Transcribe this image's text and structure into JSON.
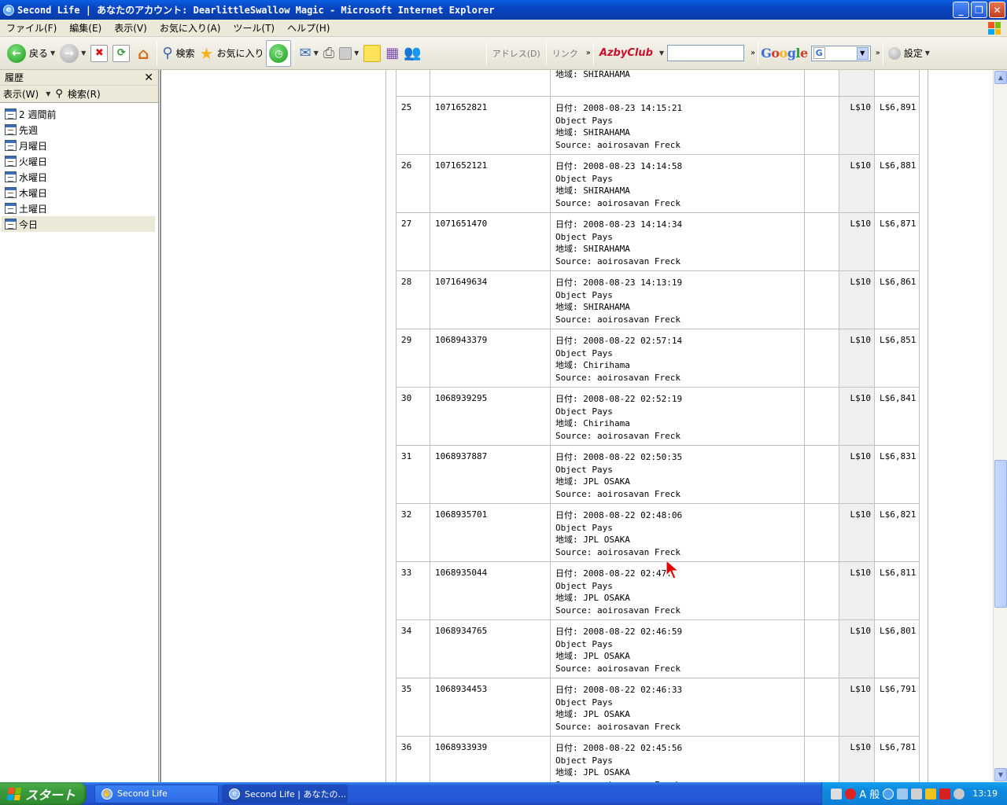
{
  "window": {
    "title": "Second Life | あなたのアカウント: DearlittleSwallow Magic - Microsoft Internet Explorer"
  },
  "menu": [
    "ファイル(F)",
    "編集(E)",
    "表示(V)",
    "お気に入り(A)",
    "ツール(T)",
    "ヘルプ(H)"
  ],
  "toolbar": {
    "back_label": "戻る",
    "search_label": "検索",
    "favorites_label": "お気に入り",
    "address_label": "アドレス(D)",
    "links_label": "リンク",
    "azby_label": "AzbyClub",
    "google_label": "Google",
    "google_select": "G",
    "settings_label": "設定"
  },
  "sidebar": {
    "title": "履歴",
    "view_label": "表示(W)",
    "search_label": "検索(R)",
    "items": [
      "2 週間前",
      "先週",
      "月曜日",
      "火曜日",
      "水曜日",
      "木曜日",
      "土曜日",
      "今日"
    ]
  },
  "partial_top": {
    "region": "地域: SHIRAHAMA"
  },
  "transactions": [
    {
      "num": "25",
      "id": "1071652821",
      "date": "日付: 2008-08-23 14:15:21",
      "type": "Object Pays",
      "region": "地域: SHIRAHAMA",
      "source": "Source: aoirosavan Freck",
      "amount": "L$10",
      "balance": "L$6,891"
    },
    {
      "num": "26",
      "id": "1071652121",
      "date": "日付: 2008-08-23 14:14:58",
      "type": "Object Pays",
      "region": "地域: SHIRAHAMA",
      "source": "Source: aoirosavan Freck",
      "amount": "L$10",
      "balance": "L$6,881"
    },
    {
      "num": "27",
      "id": "1071651470",
      "date": "日付: 2008-08-23 14:14:34",
      "type": "Object Pays",
      "region": "地域: SHIRAHAMA",
      "source": "Source: aoirosavan Freck",
      "amount": "L$10",
      "balance": "L$6,871"
    },
    {
      "num": "28",
      "id": "1071649634",
      "date": "日付: 2008-08-23 14:13:19",
      "type": "Object Pays",
      "region": "地域: SHIRAHAMA",
      "source": "Source: aoirosavan Freck",
      "amount": "L$10",
      "balance": "L$6,861"
    },
    {
      "num": "29",
      "id": "1068943379",
      "date": "日付: 2008-08-22 02:57:14",
      "type": "Object Pays",
      "region": "地域: Chirihama",
      "source": "Source: aoirosavan Freck",
      "amount": "L$10",
      "balance": "L$6,851"
    },
    {
      "num": "30",
      "id": "1068939295",
      "date": "日付: 2008-08-22 02:52:19",
      "type": "Object Pays",
      "region": "地域: Chirihama",
      "source": "Source: aoirosavan Freck",
      "amount": "L$10",
      "balance": "L$6,841"
    },
    {
      "num": "31",
      "id": "1068937887",
      "date": "日付: 2008-08-22 02:50:35",
      "type": "Object Pays",
      "region": "地域: JPL OSAKA",
      "source": "Source: aoirosavan Freck",
      "amount": "L$10",
      "balance": "L$6,831"
    },
    {
      "num": "32",
      "id": "1068935701",
      "date": "日付: 2008-08-22 02:48:06",
      "type": "Object Pays",
      "region": "地域: JPL OSAKA",
      "source": "Source: aoirosavan Freck",
      "amount": "L$10",
      "balance": "L$6,821"
    },
    {
      "num": "33",
      "id": "1068935044",
      "date": "日付: 2008-08-22 02:47:",
      "type": "Object Pays",
      "region": "地域: JPL OSAKA",
      "source": "Source: aoirosavan Freck",
      "amount": "L$10",
      "balance": "L$6,811"
    },
    {
      "num": "34",
      "id": "1068934765",
      "date": "日付: 2008-08-22 02:46:59",
      "type": "Object Pays",
      "region": "地域: JPL OSAKA",
      "source": "Source: aoirosavan Freck",
      "amount": "L$10",
      "balance": "L$6,801"
    },
    {
      "num": "35",
      "id": "1068934453",
      "date": "日付: 2008-08-22 02:46:33",
      "type": "Object Pays",
      "region": "地域: JPL OSAKA",
      "source": "Source: aoirosavan Freck",
      "amount": "L$10",
      "balance": "L$6,791"
    },
    {
      "num": "36",
      "id": "1068933939",
      "date": "日付: 2008-08-22 02:45:56",
      "type": "Object Pays",
      "region": "地域: JPL OSAKA",
      "source": "Source: aoirosavan Freck",
      "amount": "L$10",
      "balance": "L$6,781"
    }
  ],
  "taskbar": {
    "start_label": "スタート",
    "tasks": [
      "Second Life",
      "Second Life | あなたの..."
    ],
    "ime": "A 般",
    "clock": "13:19"
  },
  "colors": {
    "xp_blue": "#245edb",
    "start_green": "#3a9a3a",
    "amount_bg": "#efefef"
  }
}
